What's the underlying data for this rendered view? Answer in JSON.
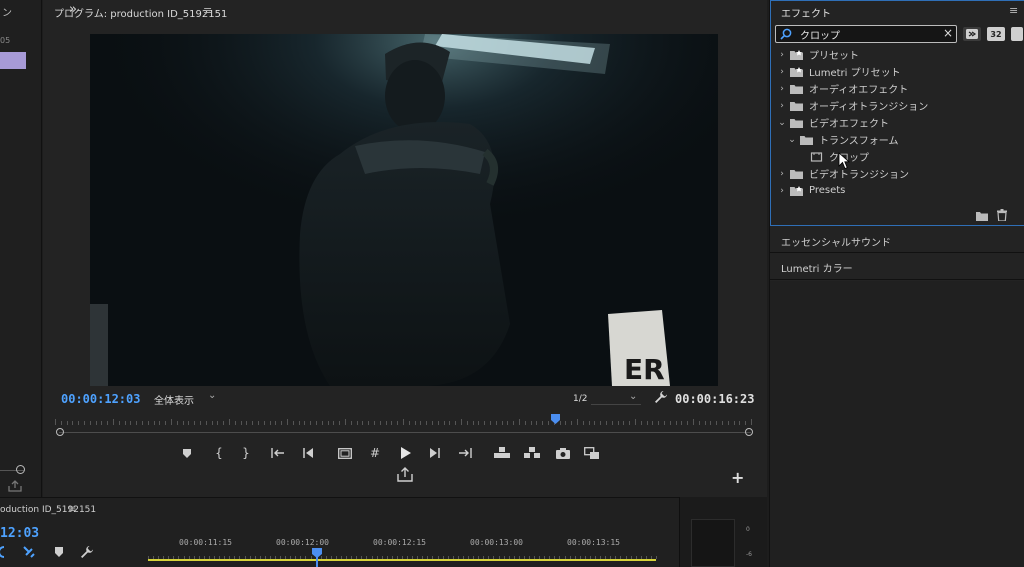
{
  "left_panel": {
    "tab_label": "ン",
    "code_label": "05"
  },
  "program_monitor": {
    "title": "プログラム: production ID_5192151",
    "timecode_current": "00:00:12:03",
    "zoom": "全体表示",
    "resolution": "1/2",
    "timecode_duration": "00:00:16:23",
    "video_sign_text": "ER"
  },
  "transport": {
    "controls": [
      "marker-icon",
      "mark-in-icon",
      "mark-out-icon",
      "go-to-in-icon",
      "step-back-icon",
      "safe-margins-icon",
      "grid-icon",
      "play-icon",
      "step-forward-icon",
      "go-to-out-icon",
      "lift-icon",
      "extract-icon",
      "camera-icon",
      "compare-icon"
    ],
    "add_label": "+"
  },
  "timeline": {
    "title": "oduction ID_5192151",
    "timecode": "12:03",
    "ruler_labels": [
      "00:00:11:15",
      "00:00:12:00",
      "00:00:12:15",
      "00:00:13:00",
      "00:00:13:15"
    ]
  },
  "audio_meter": {
    "labels": [
      "0",
      "-6"
    ]
  },
  "effects": {
    "title": "エフェクト",
    "search_value": "クロップ",
    "filter_buttons": [
      "accelerated-effects-icon",
      "32-bit-icon",
      "yuv-icon"
    ],
    "filter_32_label": "32",
    "tree": [
      {
        "label": "プリセット",
        "depth": 0,
        "expanded": false,
        "icon": "preset-folder-icon"
      },
      {
        "label": "Lumetri プリセット",
        "depth": 0,
        "expanded": false,
        "icon": "preset-folder-icon"
      },
      {
        "label": "オーディオエフェクト",
        "depth": 0,
        "expanded": false,
        "icon": "folder-icon"
      },
      {
        "label": "オーディオトランジション",
        "depth": 0,
        "expanded": false,
        "icon": "folder-icon"
      },
      {
        "label": "ビデオエフェクト",
        "depth": 0,
        "expanded": true,
        "icon": "folder-icon"
      },
      {
        "label": "トランスフォーム",
        "depth": 1,
        "expanded": true,
        "icon": "folder-icon"
      },
      {
        "label": "クロップ",
        "depth": 2,
        "expanded": null,
        "icon": "effect-icon"
      },
      {
        "label": "ビデオトランジション",
        "depth": 0,
        "expanded": false,
        "icon": "folder-icon"
      },
      {
        "label": "Presets",
        "depth": 0,
        "expanded": false,
        "icon": "preset-folder-icon"
      }
    ]
  },
  "essential_sound": {
    "label": "エッセンシャルサウンド"
  },
  "lumetri_color": {
    "label": "Lumetri カラー"
  },
  "colors": {
    "accent_blue": "#4ea2ff",
    "panel_focus": "#2f6fb7",
    "work_area": "#d6d33a",
    "clip_label": "#a79ad7"
  }
}
